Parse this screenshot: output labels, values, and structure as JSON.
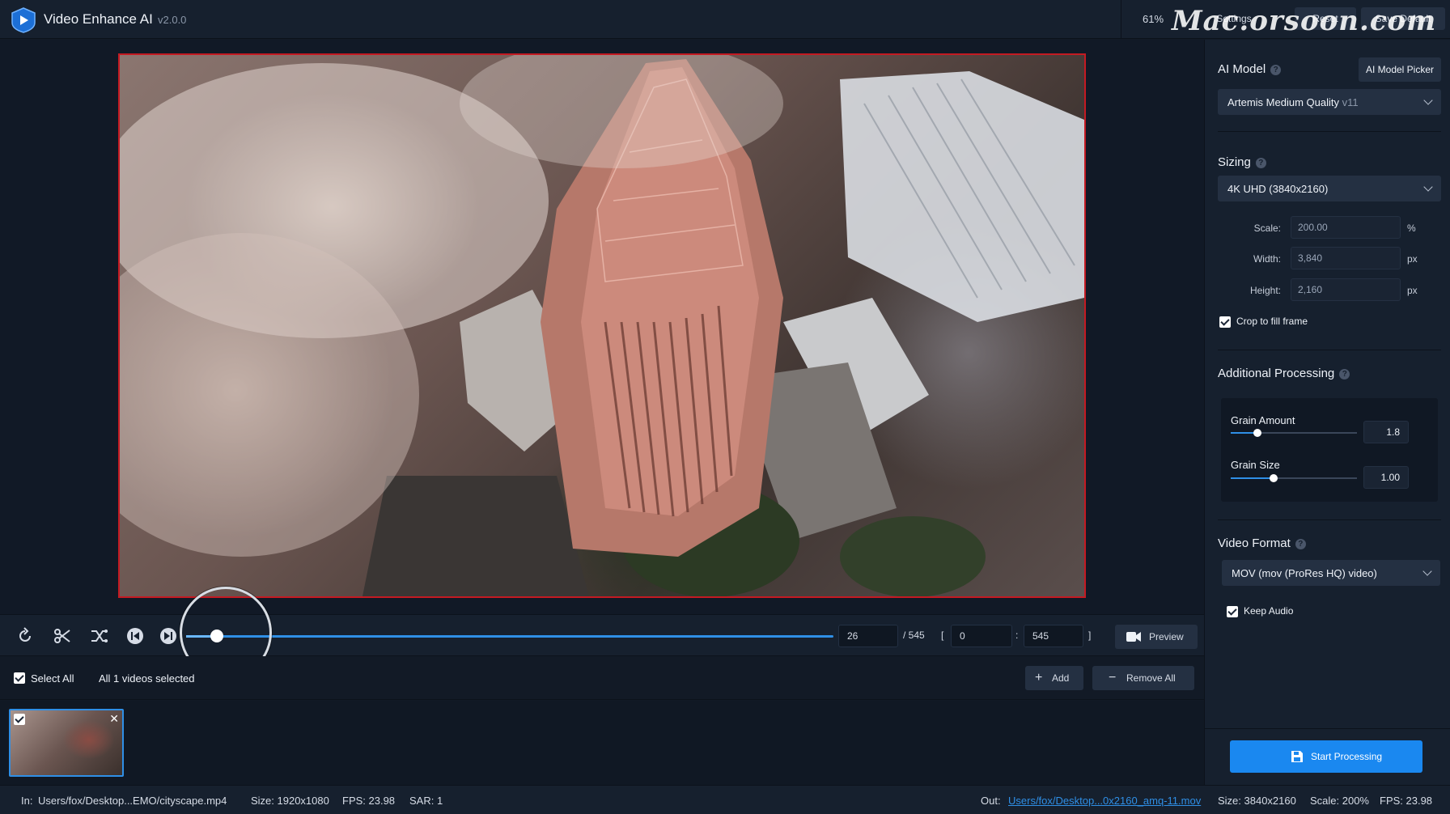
{
  "app": {
    "title": "Video Enhance AI",
    "version": "v2.0.0",
    "zoom": "61%",
    "watermark": "Mac.orsoon.com",
    "settings_label": "Settings",
    "reset_label": "Reset",
    "save_default_label": "Save Default"
  },
  "timeline": {
    "current_frame": "26",
    "total_frames": "/ 545",
    "range_open": "[",
    "range_start": "0",
    "range_sep": ":",
    "range_end": "545",
    "range_close": "]",
    "preview_label": "Preview",
    "progress_fraction": 0.048
  },
  "selection": {
    "select_all_label": "Select All",
    "selected_text": "All 1 videos selected",
    "add_label": "Add",
    "remove_all_label": "Remove All"
  },
  "status": {
    "in_label": "In:",
    "in_path": "Users/fox/Desktop...EMO/cityscape.mp4",
    "in_size": "Size:  1920x1080",
    "in_fps": "FPS:  23.98",
    "in_sar": "SAR:  1",
    "out_label": "Out:",
    "out_path": "Users/fox/Desktop...0x2160_amq-11.mov",
    "out_size": "Size:  3840x2160",
    "out_scale": "Scale:  200%",
    "out_fps": "FPS:  23.98"
  },
  "panel": {
    "ai_model": {
      "title": "AI Model",
      "picker_label": "AI Model Picker",
      "selected": "Artemis Medium Quality",
      "selected_version": "v11"
    },
    "sizing": {
      "title": "Sizing",
      "preset": "4K UHD (3840x2160)",
      "scale_label": "Scale:",
      "scale_value": "200.00",
      "scale_unit": "%",
      "width_label": "Width:",
      "width_value": "3,840",
      "width_unit": "px",
      "height_label": "Height:",
      "height_value": "2,160",
      "height_unit": "px",
      "crop_label": "Crop to fill frame"
    },
    "additional": {
      "title": "Additional Processing",
      "grain_amount_label": "Grain Amount",
      "grain_amount_value": "1.8",
      "grain_amount_level": 0.21,
      "grain_size_label": "Grain Size",
      "grain_size_value": "1.00",
      "grain_size_level": 0.34
    },
    "format": {
      "title": "Video Format",
      "selected": "MOV (mov (ProRes HQ) video)",
      "keep_audio_label": "Keep Audio"
    },
    "start_label": "Start Processing"
  },
  "colors": {
    "accent": "#2f8fe6",
    "video_border": "#c41a22",
    "panel_bg": "#16202e",
    "start_button": "#1a88f0"
  },
  "icons": [
    "logo-icon",
    "rotate-icon",
    "scissors-icon",
    "shuffle-icon",
    "previous-frame-icon",
    "next-frame-icon",
    "camera-icon",
    "plus-icon",
    "minus-icon",
    "save-icon",
    "chevron-down-icon",
    "help-icon",
    "close-icon",
    "checkbox-icon"
  ]
}
